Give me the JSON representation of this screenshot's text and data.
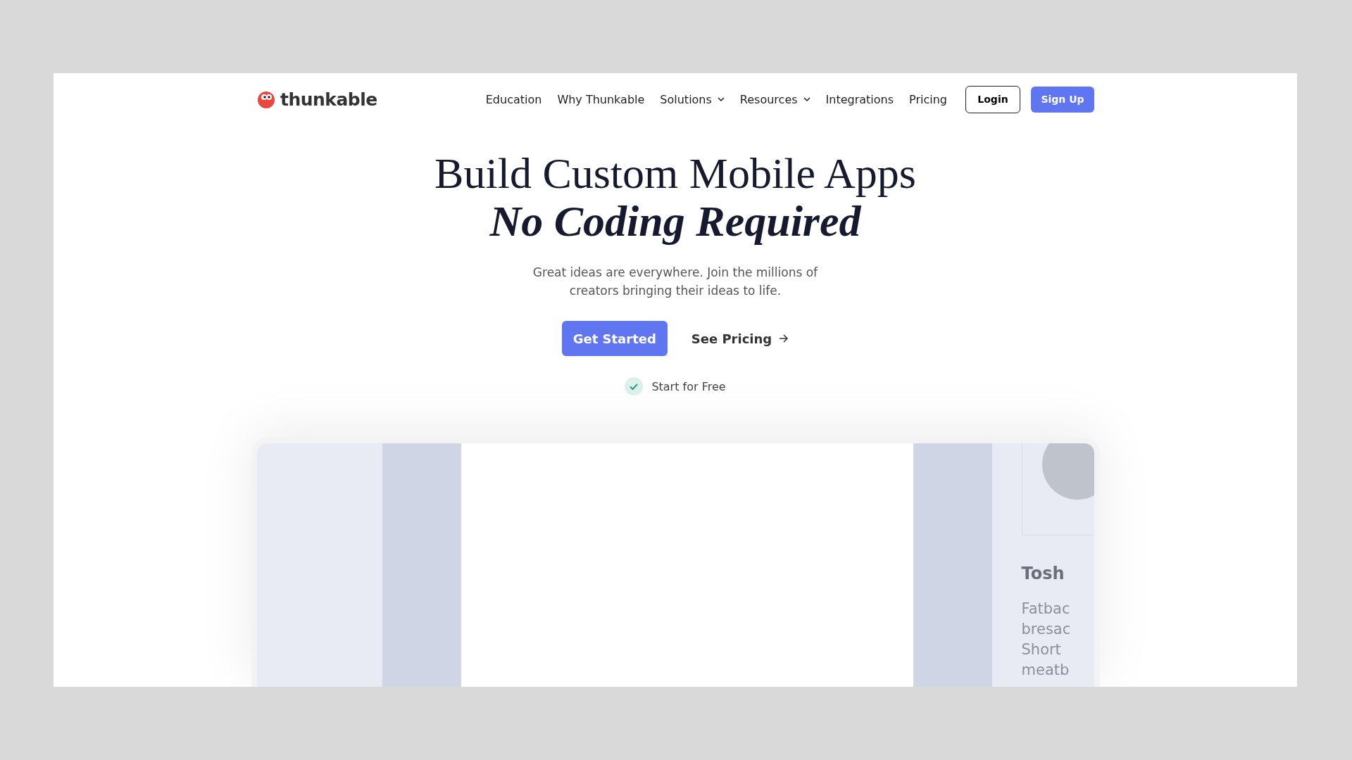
{
  "header": {
    "logo_text": "thunkable",
    "nav": [
      {
        "label": "Education",
        "kind": "link"
      },
      {
        "label": "Why Thunkable",
        "kind": "link"
      },
      {
        "label": "Solutions",
        "kind": "dropdown"
      },
      {
        "label": "Resources",
        "kind": "dropdown"
      },
      {
        "label": "Integrations",
        "kind": "link"
      },
      {
        "label": "Pricing",
        "kind": "link"
      }
    ],
    "login": "Login",
    "signup": "Sign Up"
  },
  "hero": {
    "title_line1": "Build Custom Mobile Apps",
    "title_line2": "No Coding Required",
    "subtitle": "Great ideas are everywhere. Join the millions of creators bringing their ideas to life.",
    "primary_button": "Get Started",
    "secondary_link": "See Pricing",
    "note": "Start for Free"
  },
  "preview": {
    "card_title": "Tosh",
    "card_lines": [
      "Fatbac",
      "bresac",
      "Short",
      "meatb"
    ]
  }
}
